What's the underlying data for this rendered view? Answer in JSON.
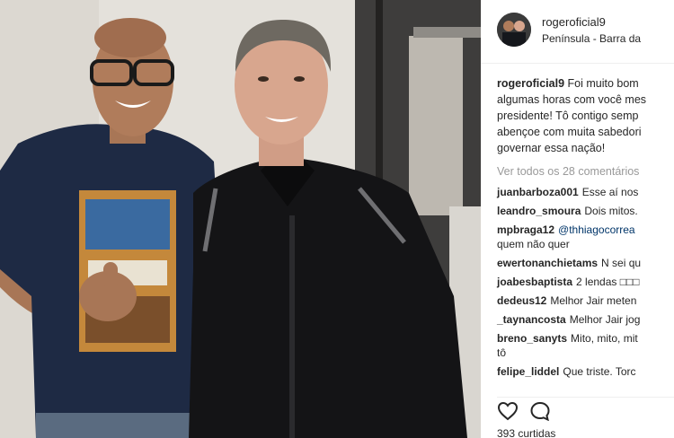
{
  "post": {
    "username": "rogeroficial9",
    "location": "Península - Barra da",
    "caption_user": "rogeroficial9",
    "caption_lines": [
      "Foi muito bom",
      "algumas horas com você mes",
      "presidente! Tô contigo semp",
      "abençoe com muita sabedori",
      "governar essa nação!"
    ],
    "view_all": "Ver todos os 28 comentários",
    "comments": [
      {
        "user": "juanbarboza001",
        "text": "Esse aí nos"
      },
      {
        "user": "leandro_smoura",
        "text": "Dois mitos."
      },
      {
        "user": "mpbraga12",
        "text": "@thhiagocorrea",
        "cont": "quem não quer",
        "mention": true
      },
      {
        "user": "ewertonanchietams",
        "text": "N sei qu"
      },
      {
        "user": "joabesbaptista",
        "text": "2 lendas □□□"
      },
      {
        "user": "dedeus12",
        "text": "Melhor Jair meten"
      },
      {
        "user": "_taynancosta",
        "text": "Melhor Jair jog"
      },
      {
        "user": "breno_sanyts",
        "text": "Mito, mito, mit",
        "cont": "tô"
      },
      {
        "user": "felipe_liddel",
        "text": "Que triste. Torc"
      }
    ],
    "likes": "393 curtidas"
  },
  "icons": {
    "like": "heart-icon",
    "comment": "comment-icon"
  },
  "colors": {
    "text": "#262626",
    "muted": "#999999",
    "mention": "#003569"
  }
}
